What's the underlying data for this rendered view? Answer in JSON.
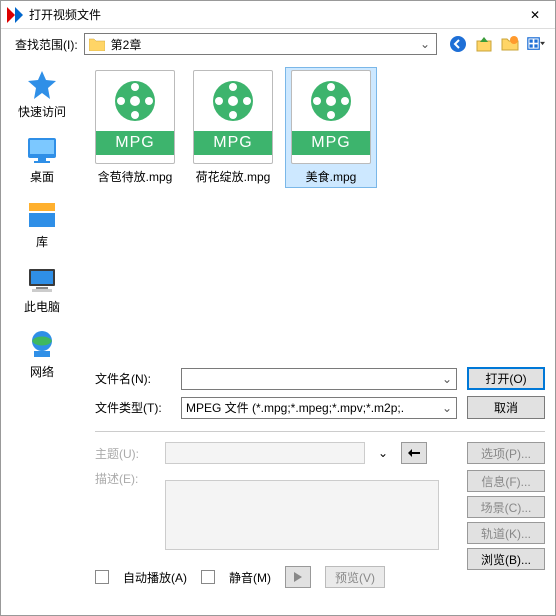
{
  "window": {
    "title": "打开视频文件",
    "close": "✕"
  },
  "lookin": {
    "label": "查找范围(I):",
    "value": "第2章"
  },
  "sidebar": [
    {
      "label": "快速访问"
    },
    {
      "label": "桌面"
    },
    {
      "label": "库"
    },
    {
      "label": "此电脑"
    },
    {
      "label": "网络"
    }
  ],
  "files": [
    {
      "ext": "MPG",
      "name": "含苞待放.mpg",
      "selected": false
    },
    {
      "ext": "MPG",
      "name": "荷花绽放.mpg",
      "selected": false
    },
    {
      "ext": "MPG",
      "name": "美食.mpg",
      "selected": true
    }
  ],
  "form": {
    "name_label": "文件名(N):",
    "name_value": "",
    "type_label": "文件类型(T):",
    "type_value": "MPEG 文件 (*.mpg;*.mpeg;*.mpv;*.m2p;.",
    "open": "打开(O)",
    "cancel": "取消"
  },
  "opts": {
    "subject_label": "主题(U):",
    "desc_label": "描述(E):",
    "autoplay": "自动播放(A)",
    "mute": "静音(M)",
    "preview": "预览(V)",
    "options": "选项(P)...",
    "info": "信息(F)...",
    "scene": "场景(C)...",
    "track": "轨道(K)...",
    "browse": "浏览(B)..."
  }
}
